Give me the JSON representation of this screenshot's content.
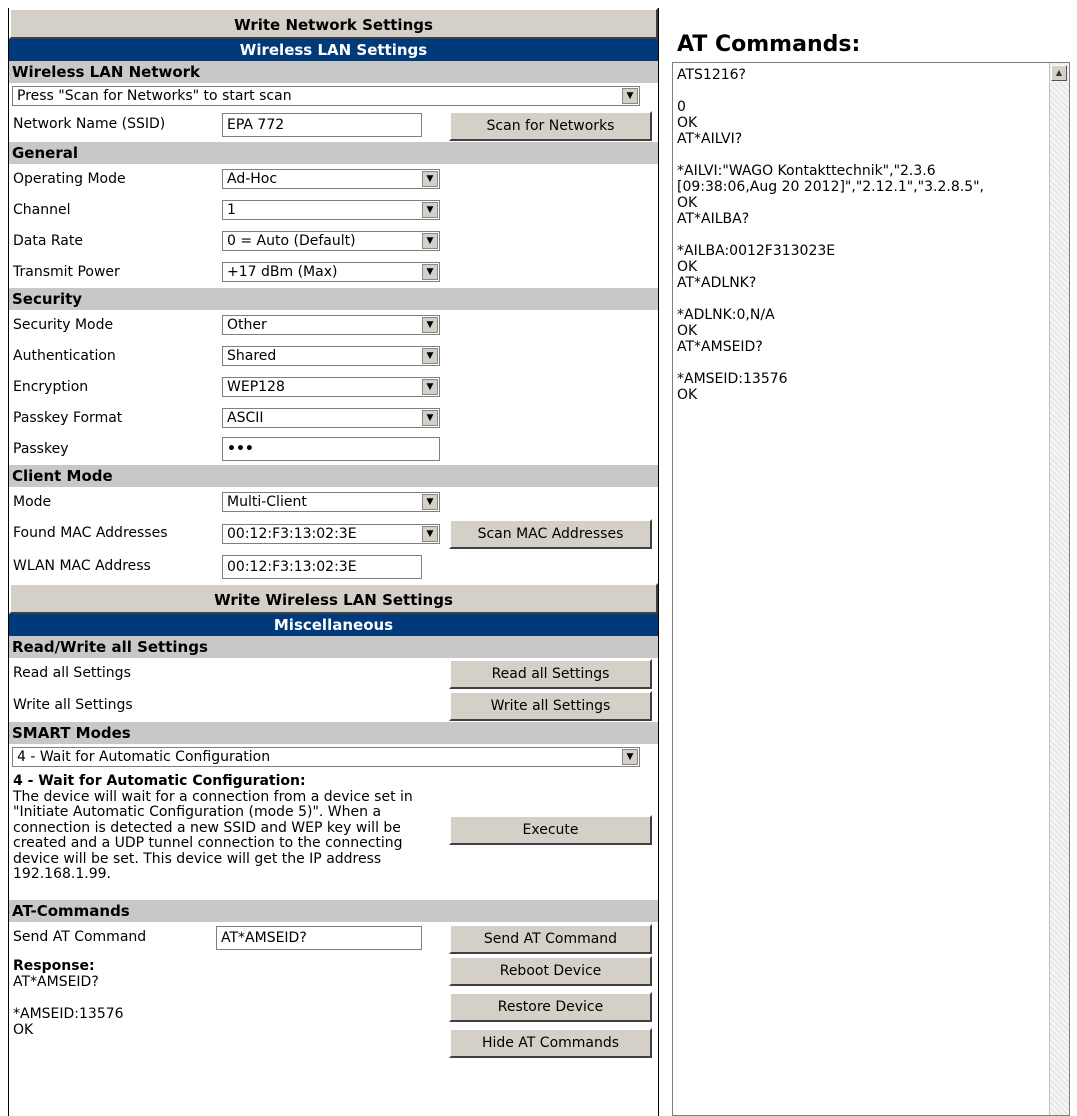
{
  "buttons": {
    "write_network": "Write Network Settings",
    "write_wlan": "Write Wireless LAN Settings",
    "scan_networks": "Scan for Networks",
    "scan_mac": "Scan MAC Addresses",
    "read_all": "Read all Settings",
    "write_all": "Write all Settings",
    "execute": "Execute",
    "send_at": "Send AT Command",
    "reboot": "Reboot Device",
    "restore": "Restore Device",
    "hide_at": "Hide AT Commands"
  },
  "headers": {
    "wlan_settings": "Wireless LAN Settings",
    "misc": "Miscellaneous"
  },
  "sections": {
    "wlan_network": "Wireless LAN Network",
    "general": "General",
    "security": "Security",
    "client_mode": "Client Mode",
    "read_write": "Read/Write all Settings",
    "smart_modes": "SMART Modes",
    "at_commands": "AT-Commands"
  },
  "network": {
    "scan_select": "Press \"Scan for Networks\" to start scan",
    "ssid_label": "Network Name (SSID)",
    "ssid_value": "EPA 772"
  },
  "general": {
    "operating_mode_label": "Operating Mode",
    "operating_mode_value": "Ad-Hoc",
    "channel_label": "Channel",
    "channel_value": "1",
    "data_rate_label": "Data Rate",
    "data_rate_value": "0 = Auto (Default)",
    "transmit_power_label": "Transmit Power",
    "transmit_power_value": "+17 dBm (Max)"
  },
  "security": {
    "security_mode_label": "Security Mode",
    "security_mode_value": "Other",
    "auth_label": "Authentication",
    "auth_value": "Shared",
    "encryption_label": "Encryption",
    "encryption_value": "WEP128",
    "passkey_format_label": "Passkey Format",
    "passkey_format_value": "ASCII",
    "passkey_label": "Passkey",
    "passkey_value": "•••"
  },
  "client": {
    "mode_label": "Mode",
    "mode_value": "Multi-Client",
    "found_mac_label": "Found MAC Addresses",
    "found_mac_value": "00:12:F3:13:02:3E",
    "wlan_mac_label": "WLAN MAC Address",
    "wlan_mac_value": "00:12:F3:13:02:3E"
  },
  "misc": {
    "read_all_label": "Read all Settings",
    "write_all_label": "Write all Settings",
    "smart_select": "4 - Wait for Automatic Configuration",
    "smart_desc_title": "4 - Wait for Automatic Configuration:",
    "smart_desc_body": "The device will wait for a connection from a device set in \"Initiate Automatic Configuration (mode 5)\". When a connection is detected a new SSID and WEP key will be created and a UDP tunnel connection to the connecting device will be set. This device will get the IP address 192.168.1.99.",
    "send_at_label": "Send AT Command",
    "send_at_value": "AT*AMSEID?",
    "response_title": "Response:",
    "response_body": "AT*AMSEID?\n\n*AMSEID:13576\nOK"
  },
  "at_panel": {
    "title": "AT Commands:",
    "log": "ATS1216?\n\n0\nOK\nAT*AILVI?\n\n*AILVI:\"WAGO Kontakttechnik\",\"2.3.6\n[09:38:06,Aug 20 2012]\",\"2.12.1\",\"3.2.8.5\",\nOK\nAT*AILBA?\n\n*AILBA:0012F313023E\nOK\nAT*ADLNK?\n\n*ADLNK:0,N/A\nOK\nAT*AMSEID?\n\n*AMSEID:13576\nOK"
  }
}
